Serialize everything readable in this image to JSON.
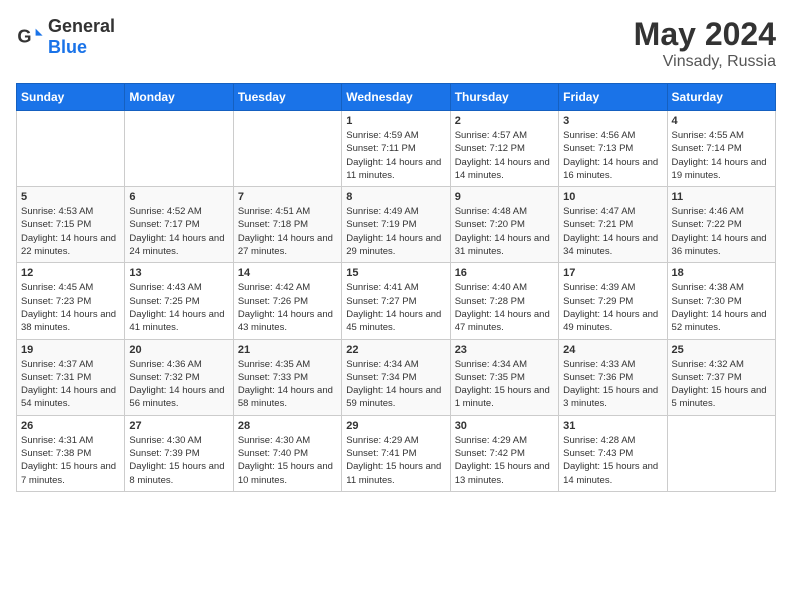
{
  "header": {
    "logo_general": "General",
    "logo_blue": "Blue",
    "title": "May 2024",
    "location": "Vinsady, Russia"
  },
  "weekdays": [
    "Sunday",
    "Monday",
    "Tuesday",
    "Wednesday",
    "Thursday",
    "Friday",
    "Saturday"
  ],
  "weeks": [
    [
      {
        "day": "",
        "info": ""
      },
      {
        "day": "",
        "info": ""
      },
      {
        "day": "",
        "info": ""
      },
      {
        "day": "1",
        "sunrise": "4:59 AM",
        "sunset": "7:11 PM",
        "daylight": "14 hours and 11 minutes."
      },
      {
        "day": "2",
        "sunrise": "4:57 AM",
        "sunset": "7:12 PM",
        "daylight": "14 hours and 14 minutes."
      },
      {
        "day": "3",
        "sunrise": "4:56 AM",
        "sunset": "7:13 PM",
        "daylight": "14 hours and 16 minutes."
      },
      {
        "day": "4",
        "sunrise": "4:55 AM",
        "sunset": "7:14 PM",
        "daylight": "14 hours and 19 minutes."
      }
    ],
    [
      {
        "day": "5",
        "sunrise": "4:53 AM",
        "sunset": "7:15 PM",
        "daylight": "14 hours and 22 minutes."
      },
      {
        "day": "6",
        "sunrise": "4:52 AM",
        "sunset": "7:17 PM",
        "daylight": "14 hours and 24 minutes."
      },
      {
        "day": "7",
        "sunrise": "4:51 AM",
        "sunset": "7:18 PM",
        "daylight": "14 hours and 27 minutes."
      },
      {
        "day": "8",
        "sunrise": "4:49 AM",
        "sunset": "7:19 PM",
        "daylight": "14 hours and 29 minutes."
      },
      {
        "day": "9",
        "sunrise": "4:48 AM",
        "sunset": "7:20 PM",
        "daylight": "14 hours and 31 minutes."
      },
      {
        "day": "10",
        "sunrise": "4:47 AM",
        "sunset": "7:21 PM",
        "daylight": "14 hours and 34 minutes."
      },
      {
        "day": "11",
        "sunrise": "4:46 AM",
        "sunset": "7:22 PM",
        "daylight": "14 hours and 36 minutes."
      }
    ],
    [
      {
        "day": "12",
        "sunrise": "4:45 AM",
        "sunset": "7:23 PM",
        "daylight": "14 hours and 38 minutes."
      },
      {
        "day": "13",
        "sunrise": "4:43 AM",
        "sunset": "7:25 PM",
        "daylight": "14 hours and 41 minutes."
      },
      {
        "day": "14",
        "sunrise": "4:42 AM",
        "sunset": "7:26 PM",
        "daylight": "14 hours and 43 minutes."
      },
      {
        "day": "15",
        "sunrise": "4:41 AM",
        "sunset": "7:27 PM",
        "daylight": "14 hours and 45 minutes."
      },
      {
        "day": "16",
        "sunrise": "4:40 AM",
        "sunset": "7:28 PM",
        "daylight": "14 hours and 47 minutes."
      },
      {
        "day": "17",
        "sunrise": "4:39 AM",
        "sunset": "7:29 PM",
        "daylight": "14 hours and 49 minutes."
      },
      {
        "day": "18",
        "sunrise": "4:38 AM",
        "sunset": "7:30 PM",
        "daylight": "14 hours and 52 minutes."
      }
    ],
    [
      {
        "day": "19",
        "sunrise": "4:37 AM",
        "sunset": "7:31 PM",
        "daylight": "14 hours and 54 minutes."
      },
      {
        "day": "20",
        "sunrise": "4:36 AM",
        "sunset": "7:32 PM",
        "daylight": "14 hours and 56 minutes."
      },
      {
        "day": "21",
        "sunrise": "4:35 AM",
        "sunset": "7:33 PM",
        "daylight": "14 hours and 58 minutes."
      },
      {
        "day": "22",
        "sunrise": "4:34 AM",
        "sunset": "7:34 PM",
        "daylight": "14 hours and 59 minutes."
      },
      {
        "day": "23",
        "sunrise": "4:34 AM",
        "sunset": "7:35 PM",
        "daylight": "15 hours and 1 minute."
      },
      {
        "day": "24",
        "sunrise": "4:33 AM",
        "sunset": "7:36 PM",
        "daylight": "15 hours and 3 minutes."
      },
      {
        "day": "25",
        "sunrise": "4:32 AM",
        "sunset": "7:37 PM",
        "daylight": "15 hours and 5 minutes."
      }
    ],
    [
      {
        "day": "26",
        "sunrise": "4:31 AM",
        "sunset": "7:38 PM",
        "daylight": "15 hours and 7 minutes."
      },
      {
        "day": "27",
        "sunrise": "4:30 AM",
        "sunset": "7:39 PM",
        "daylight": "15 hours and 8 minutes."
      },
      {
        "day": "28",
        "sunrise": "4:30 AM",
        "sunset": "7:40 PM",
        "daylight": "15 hours and 10 minutes."
      },
      {
        "day": "29",
        "sunrise": "4:29 AM",
        "sunset": "7:41 PM",
        "daylight": "15 hours and 11 minutes."
      },
      {
        "day": "30",
        "sunrise": "4:29 AM",
        "sunset": "7:42 PM",
        "daylight": "15 hours and 13 minutes."
      },
      {
        "day": "31",
        "sunrise": "4:28 AM",
        "sunset": "7:43 PM",
        "daylight": "15 hours and 14 minutes."
      },
      {
        "day": "",
        "info": ""
      }
    ]
  ]
}
